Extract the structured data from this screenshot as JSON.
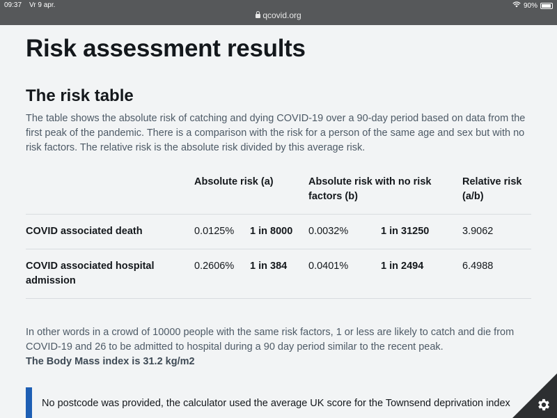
{
  "status": {
    "time": "09:37",
    "date": "Vr 9 apr.",
    "battery": "90%"
  },
  "url": "qcovid.org",
  "page_title": "Risk assessment results",
  "section_title": "The risk table",
  "intro": "The table shows the absolute risk of catching and dying COVID-19 over a 90-day period based on data from the first peak of the pandemic. There is a comparison with the risk for a person of the same age and sex but with no risk factors. The relative risk is the absolute risk divided by this average risk.",
  "table": {
    "headers": [
      "",
      "Absolute risk (a)",
      "Absolute risk with no risk factors (b)",
      "Relative risk (a/b)"
    ],
    "rows": [
      {
        "label": "COVID associated death",
        "abs_pct": "0.0125%",
        "abs_ratio": "1 in 8000",
        "base_pct": "0.0032%",
        "base_ratio": "1 in 31250",
        "relative": "3.9062"
      },
      {
        "label": "COVID associated hospital admission",
        "abs_pct": "0.2606%",
        "abs_ratio": "1 in 384",
        "base_pct": "0.0401%",
        "base_ratio": "1 in 2494",
        "relative": "6.4988"
      }
    ]
  },
  "summary": "In other words in a crowd of 10000 people with the same risk factors, 1 or less are likely to catch and die from COVID-19 and 26 to be admitted to hospital during a 90 day period similar to the recent peak.",
  "bmi": "The Body Mass index is 31.2 kg/m2",
  "notice": "No postcode was provided, the calculator used the average UK score for the Townsend deprivation index",
  "icons": {
    "settings": "gear-icon",
    "lock": "lock-icon",
    "wifi": "wifi-icon",
    "battery": "battery-icon"
  },
  "colors": {
    "notice_accent": "#1e5fb4",
    "status_bg": "#56585a",
    "corner_bg": "#2d2f31"
  }
}
